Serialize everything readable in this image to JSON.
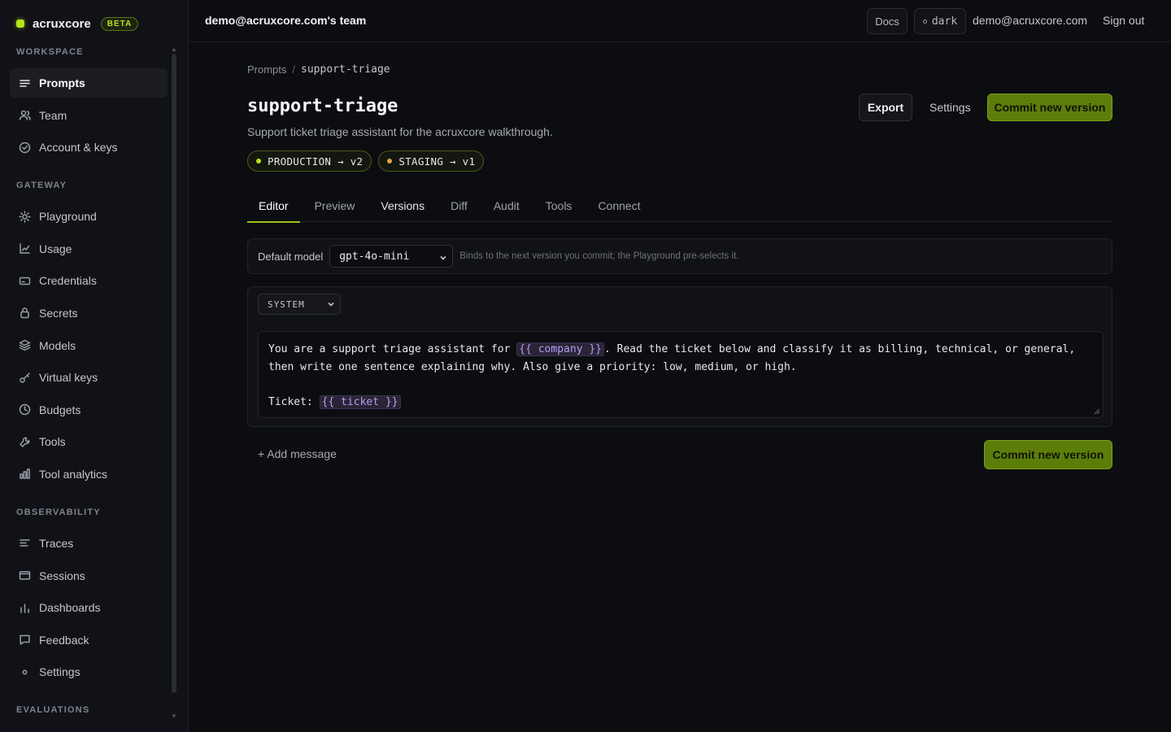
{
  "brand": {
    "name": "acruxcore",
    "badge": "BETA",
    "accent": "#b5e61d"
  },
  "sidebar": {
    "sections": [
      {
        "label": "WORKSPACE",
        "items": [
          {
            "label": "Prompts",
            "icon": "lines-icon",
            "active": true
          },
          {
            "label": "Team",
            "icon": "users-icon"
          },
          {
            "label": "Account & keys",
            "icon": "check-circle-icon"
          }
        ]
      },
      {
        "label": "GATEWAY",
        "items": [
          {
            "label": "Playground",
            "icon": "sun-icon"
          },
          {
            "label": "Usage",
            "icon": "line-chart-icon"
          },
          {
            "label": "Credentials",
            "icon": "card-icon"
          },
          {
            "label": "Secrets",
            "icon": "lock-icon"
          },
          {
            "label": "Models",
            "icon": "layers-icon"
          },
          {
            "label": "Virtual keys",
            "icon": "key-icon"
          },
          {
            "label": "Budgets",
            "icon": "clock-icon"
          },
          {
            "label": "Tools",
            "icon": "wrench-icon"
          },
          {
            "label": "Tool analytics",
            "icon": "bar-chart-icon"
          }
        ]
      },
      {
        "label": "OBSERVABILITY",
        "items": [
          {
            "label": "Traces",
            "icon": "traces-icon"
          },
          {
            "label": "Sessions",
            "icon": "window-icon"
          },
          {
            "label": "Dashboards",
            "icon": "bars-icon"
          },
          {
            "label": "Feedback",
            "icon": "message-icon"
          },
          {
            "label": "Settings",
            "icon": "dot-icon"
          }
        ]
      },
      {
        "label": "EVALUATIONS",
        "items": []
      }
    ]
  },
  "topbar": {
    "team": "demo@acruxcore.com's team",
    "docs": "Docs",
    "theme": "dark",
    "email": "demo@acruxcore.com",
    "signout": "Sign out"
  },
  "breadcrumb": {
    "root": "Prompts",
    "sep": "/",
    "current": "support-triage"
  },
  "prompt": {
    "title": "support-triage",
    "description": "Support ticket triage assistant for the acruxcore walkthrough.",
    "labels": [
      {
        "text": "PRODUCTION → v2",
        "dot": "#b5e61d"
      },
      {
        "text": "STAGING → v1",
        "dot": "#e0a43c"
      }
    ]
  },
  "header_actions": {
    "export": "Export",
    "settings": "Settings",
    "commit": "Commit new version"
  },
  "tabs": [
    {
      "label": "Editor",
      "active": true
    },
    {
      "label": "Preview"
    },
    {
      "label": "Versions",
      "bold": true
    },
    {
      "label": "Diff"
    },
    {
      "label": "Audit"
    },
    {
      "label": "Tools"
    },
    {
      "label": "Connect"
    }
  ],
  "model": {
    "label": "Default model",
    "value": "gpt-4o-mini",
    "hint": "Binds to the next version you commit; the Playground pre-selects it."
  },
  "message": {
    "role": "SYSTEM",
    "line1_a": "You are a support triage assistant for ",
    "var_company": "{{ company }}",
    "line1_b": ". Read the ticket below and classify it as billing, technical, or general,",
    "line2": "then write one sentence explaining why. Also give a priority: low, medium, or high.",
    "line4_a": "Ticket: ",
    "var_ticket": "{{ ticket }}"
  },
  "footer": {
    "add_message": "+ Add message",
    "commit": "Commit new version"
  }
}
